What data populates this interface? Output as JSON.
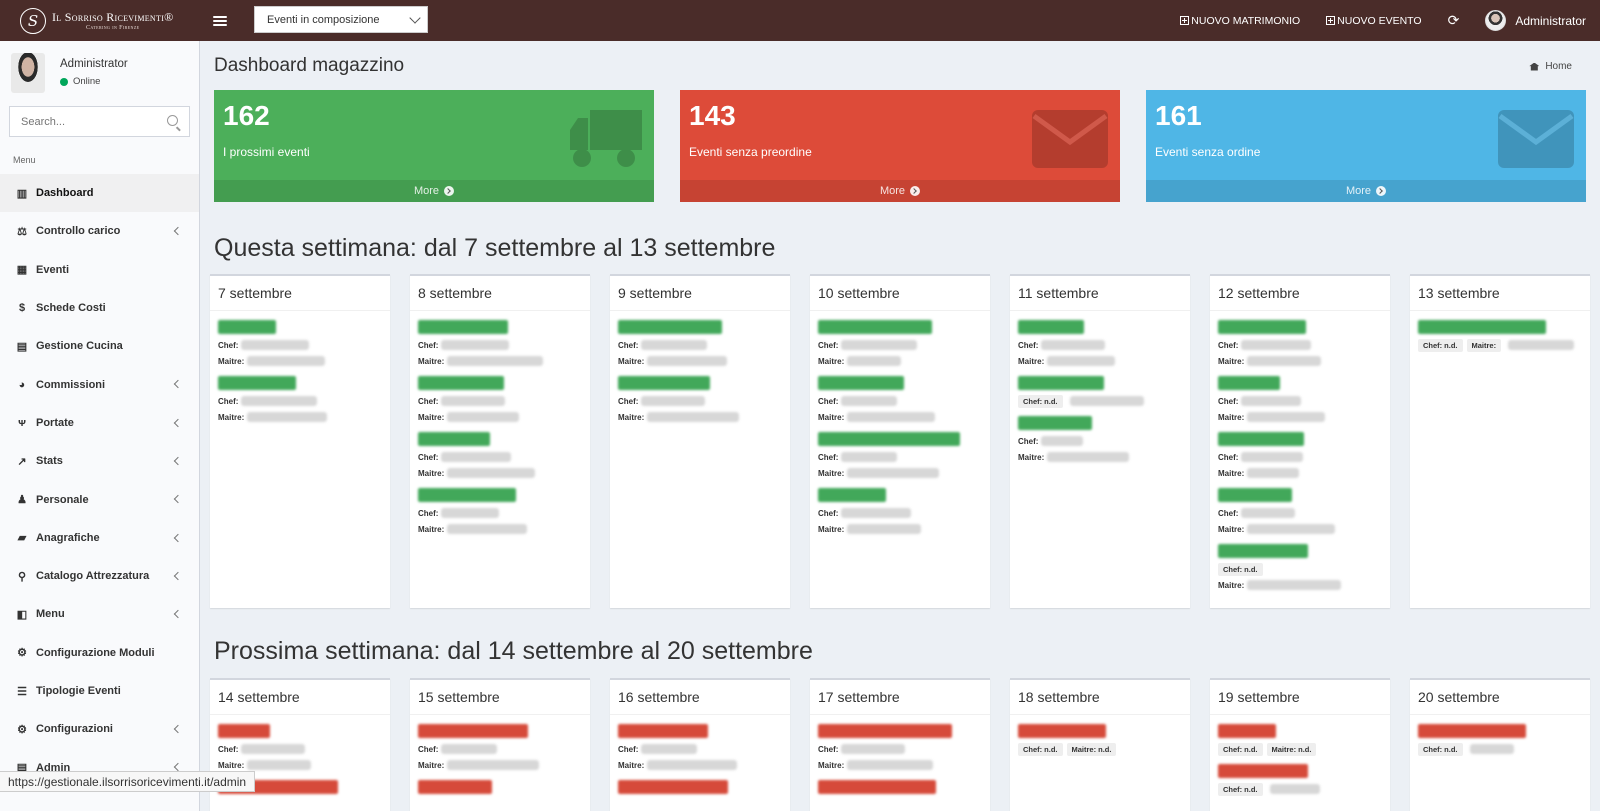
{
  "brand": {
    "name": "Il Sorriso Ricevimenti®",
    "sub": "Catering in Firenze",
    "logo_letter": "S"
  },
  "top": {
    "select_value": "Eventi in composizione",
    "new_wedding": "NUOVO MATRIMONIO",
    "new_event": "NUOVO EVENTO",
    "user": "Administrator"
  },
  "sidebar": {
    "user_name": "Administrator",
    "user_status": "Online",
    "search_placeholder": "Search...",
    "menu_header": "Menu",
    "items": [
      {
        "label": "Dashboard",
        "icon": "▥",
        "chevron": false
      },
      {
        "label": "Controllo carico",
        "icon": "⚖",
        "chevron": true
      },
      {
        "label": "Eventi",
        "icon": "▦",
        "chevron": false
      },
      {
        "label": "Schede Costi",
        "icon": "$",
        "chevron": false
      },
      {
        "label": "Gestione Cucina",
        "icon": "▤",
        "chevron": false
      },
      {
        "label": "Commissioni",
        "icon": "◕",
        "chevron": true
      },
      {
        "label": "Portate",
        "icon": "ᴪ",
        "chevron": true
      },
      {
        "label": "Stats",
        "icon": "↗",
        "chevron": true
      },
      {
        "label": "Personale",
        "icon": "♟",
        "chevron": true
      },
      {
        "label": "Anagrafiche",
        "icon": "▰",
        "chevron": true
      },
      {
        "label": "Catalogo Attrezzatura",
        "icon": "⚲",
        "chevron": true
      },
      {
        "label": "Menu",
        "icon": "◧",
        "chevron": true
      },
      {
        "label": "Configurazione Moduli",
        "icon": "⚙",
        "chevron": false
      },
      {
        "label": "Tipologie Eventi",
        "icon": "☰",
        "chevron": false
      },
      {
        "label": "Configurazioni",
        "icon": "⚙",
        "chevron": true
      },
      {
        "label": "Admin",
        "icon": "▤",
        "chevron": true
      }
    ]
  },
  "page": {
    "title": "Dashboard magazzino",
    "breadcrumb": "Home"
  },
  "boxes": [
    {
      "value": "162",
      "label": "I prossimi eventi",
      "more": "More",
      "color": "#4caf5a",
      "icon": "truck-icon"
    },
    {
      "value": "143",
      "label": "Eventi senza preordine",
      "more": "More",
      "color": "#dd4b39",
      "icon": "envelope-icon"
    },
    {
      "value": "161",
      "label": "Eventi senza ordine",
      "more": "More",
      "color": "#4fb6e6",
      "icon": "envelope-icon"
    }
  ],
  "labels": {
    "chef": "Chef:",
    "maitre": "Maitre:",
    "nd": "n.d."
  },
  "weeks": [
    {
      "title": "Questa settimana: dal 7 settembre al 13 settembre",
      "bar_color": "green",
      "days": [
        {
          "label": "7 settembre",
          "events": [
            {
              "bar": 58,
              "rows": [
                {
                  "type": "chef",
                  "blur": 68
                },
                {
                  "type": "maitre",
                  "blur": 78
                }
              ]
            },
            {
              "bar": 78,
              "rows": [
                {
                  "type": "chef",
                  "blur": 76
                },
                {
                  "type": "maitre",
                  "blur": 80
                }
              ]
            }
          ]
        },
        {
          "label": "8 settembre",
          "events": [
            {
              "bar": 90,
              "rows": [
                {
                  "type": "chef",
                  "blur": 68
                },
                {
                  "type": "maitre",
                  "blur": 96
                }
              ]
            },
            {
              "bar": 86,
              "rows": [
                {
                  "type": "chef",
                  "blur": 64
                },
                {
                  "type": "maitre",
                  "blur": 72
                }
              ]
            },
            {
              "bar": 72,
              "rows": [
                {
                  "type": "chef",
                  "blur": 70
                },
                {
                  "type": "maitre",
                  "blur": 88
                }
              ]
            },
            {
              "bar": 98,
              "rows": [
                {
                  "type": "chef",
                  "blur": 58
                },
                {
                  "type": "maitre",
                  "blur": 80
                }
              ]
            }
          ]
        },
        {
          "label": "9 settembre",
          "events": [
            {
              "bar": 104,
              "rows": [
                {
                  "type": "chef",
                  "blur": 66
                },
                {
                  "type": "maitre",
                  "blur": 80
                }
              ]
            },
            {
              "bar": 92,
              "rows": [
                {
                  "type": "chef",
                  "blur": 64
                },
                {
                  "type": "maitre",
                  "blur": 92
                }
              ]
            }
          ]
        },
        {
          "label": "10 settembre",
          "events": [
            {
              "bar": 114,
              "rows": [
                {
                  "type": "chef",
                  "blur": 76
                },
                {
                  "type": "maitre",
                  "blur": 54
                }
              ]
            },
            {
              "bar": 86,
              "rows": [
                {
                  "type": "chef",
                  "blur": 56
                },
                {
                  "type": "maitre",
                  "blur": 88
                }
              ]
            },
            {
              "bar": 142,
              "rows": [
                {
                  "type": "chef",
                  "blur": 56
                },
                {
                  "type": "maitre",
                  "blur": 92
                }
              ]
            },
            {
              "bar": 68,
              "rows": [
                {
                  "type": "chef",
                  "blur": 70
                },
                {
                  "type": "maitre",
                  "blur": 74
                }
              ]
            }
          ]
        },
        {
          "label": "11 settembre",
          "events": [
            {
              "bar": 66,
              "rows": [
                {
                  "type": "chef",
                  "blur": 64
                },
                {
                  "type": "maitre",
                  "blur": 68
                }
              ]
            },
            {
              "bar": 86,
              "rows": [
                {
                  "type": "chefnd",
                  "blur": 74
                }
              ]
            },
            {
              "bar": 74,
              "rows": [
                {
                  "type": "chef",
                  "blur": 42
                },
                {
                  "type": "maitre",
                  "blur": 82
                }
              ]
            }
          ]
        },
        {
          "label": "12 settembre",
          "events": [
            {
              "bar": 88,
              "rows": [
                {
                  "type": "chef",
                  "blur": 70
                },
                {
                  "type": "maitre",
                  "blur": 74
                }
              ]
            },
            {
              "bar": 62,
              "rows": [
                {
                  "type": "chef",
                  "blur": 60
                },
                {
                  "type": "maitre",
                  "blur": 78
                }
              ]
            },
            {
              "bar": 86,
              "rows": [
                {
                  "type": "chef",
                  "blur": 62
                },
                {
                  "type": "maitre",
                  "blur": 52
                }
              ]
            },
            {
              "bar": 74,
              "rows": [
                {
                  "type": "chef",
                  "blur": 54
                },
                {
                  "type": "maitre",
                  "blur": 88
                }
              ]
            },
            {
              "bar": 90,
              "rows": [
                {
                  "type": "chefnd",
                  "blur": 0
                },
                {
                  "type": "maitre",
                  "blur": 94
                }
              ]
            }
          ]
        },
        {
          "label": "13 settembre",
          "events": [
            {
              "bar": 128,
              "rows": [
                {
                  "type": "chefnd_maitre",
                  "blur": 66
                }
              ]
            }
          ]
        }
      ]
    },
    {
      "title": "Prossima settimana: dal 14 settembre al 20 settembre",
      "bar_color": "red",
      "days": [
        {
          "label": "14 settembre",
          "events": [
            {
              "bar": 52,
              "rows": [
                {
                  "type": "chef",
                  "blur": 64
                },
                {
                  "type": "maitre",
                  "blur": 64
                }
              ]
            },
            {
              "bar": 120,
              "rows": []
            }
          ]
        },
        {
          "label": "15 settembre",
          "events": [
            {
              "bar": 110,
              "rows": [
                {
                  "type": "chef",
                  "blur": 56
                },
                {
                  "type": "maitre",
                  "blur": 92
                }
              ]
            },
            {
              "bar": 74,
              "rows": []
            }
          ]
        },
        {
          "label": "16 settembre",
          "events": [
            {
              "bar": 90,
              "rows": [
                {
                  "type": "chef",
                  "blur": 56
                },
                {
                  "type": "maitre",
                  "blur": 90
                }
              ]
            },
            {
              "bar": 110,
              "rows": []
            }
          ]
        },
        {
          "label": "17 settembre",
          "events": [
            {
              "bar": 134,
              "rows": [
                {
                  "type": "chef",
                  "blur": 64
                },
                {
                  "type": "maitre",
                  "blur": 86
                }
              ]
            },
            {
              "bar": 118,
              "rows": []
            }
          ]
        },
        {
          "label": "18 settembre",
          "events": [
            {
              "bar": 88,
              "rows": [
                {
                  "type": "chefnd_maitrend",
                  "blur": 0
                }
              ]
            }
          ]
        },
        {
          "label": "19 settembre",
          "events": [
            {
              "bar": 58,
              "rows": [
                {
                  "type": "chefnd_maitrend",
                  "blur": 0
                }
              ]
            },
            {
              "bar": 90,
              "rows": [
                {
                  "type": "chefnd",
                  "blur": 50
                }
              ]
            }
          ]
        },
        {
          "label": "20 settembre",
          "events": [
            {
              "bar": 108,
              "rows": [
                {
                  "type": "chefnd",
                  "blur": 44
                }
              ]
            }
          ]
        }
      ]
    }
  ],
  "status_url": "https://gestionale.ilsorrisoricevimenti.it/admin"
}
